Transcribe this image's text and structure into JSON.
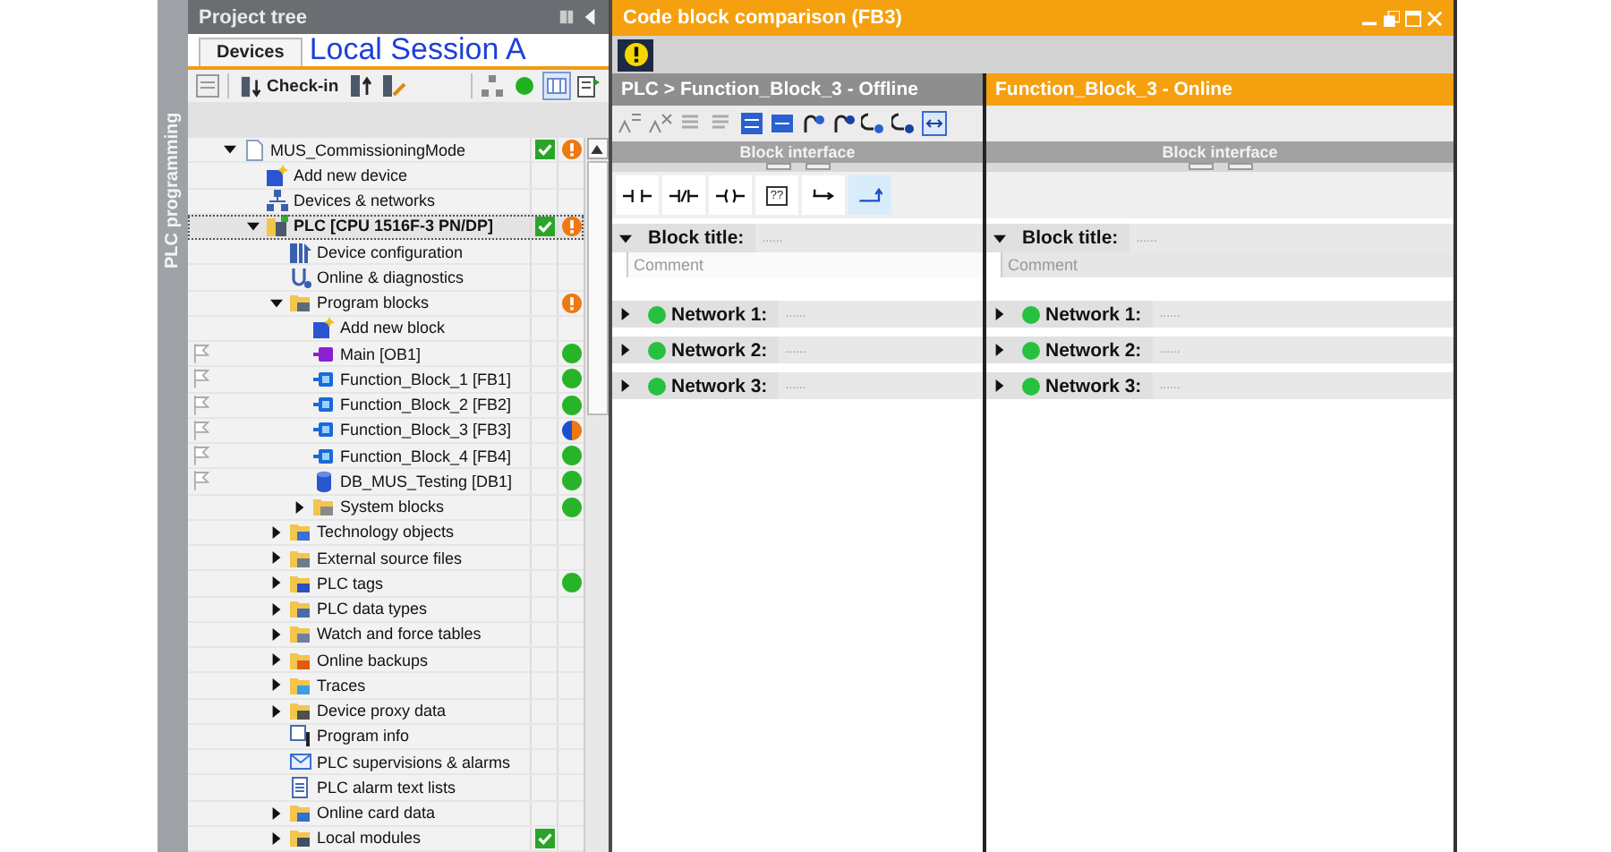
{
  "sidebar": {
    "label": "PLC programming"
  },
  "project_tree": {
    "title": "Project tree",
    "tabs": [
      {
        "label": "Devices",
        "selected": true
      }
    ],
    "annotation": "Local Session A",
    "toolbar": {
      "checkin_label": "Check-in"
    },
    "items": [
      {
        "label": "MUS_CommissioningMode",
        "kind": "project",
        "expanded": true,
        "selected": false,
        "flag": false,
        "check": true,
        "warning": true,
        "children": [
          {
            "label": "Add new device",
            "kind": "add_device",
            "selected": false,
            "flag": false,
            "check": false
          },
          {
            "label": "Devices & networks",
            "kind": "network",
            "selected": false,
            "flag": false,
            "check": false
          },
          {
            "label": "PLC [CPU 1516F-3 PN/DP]",
            "kind": "plc",
            "expanded": true,
            "selected": true,
            "flag": false,
            "check": true,
            "warning": true,
            "children": [
              {
                "label": "Device configuration",
                "kind": "config",
                "selected": false,
                "flag": false,
                "check": false
              },
              {
                "label": "Online & diagnostics",
                "kind": "diagnostics",
                "selected": false,
                "flag": false,
                "check": false
              },
              {
                "label": "Program blocks",
                "kind": "folder_blocks",
                "expanded": true,
                "selected": false,
                "flag": false,
                "check": false,
                "warning": true,
                "children": [
                  {
                    "label": "Add new block",
                    "kind": "add_block",
                    "selected": false,
                    "flag": false,
                    "check": false
                  },
                  {
                    "label": "Main [OB1]",
                    "kind": "ob",
                    "selected": false,
                    "flag": true,
                    "check": false,
                    "online_ok": true
                  },
                  {
                    "label": "Function_Block_1 [FB1]",
                    "kind": "fb",
                    "selected": false,
                    "flag": true,
                    "check": false,
                    "online_ok": true
                  },
                  {
                    "label": "Function_Block_2 [FB2]",
                    "kind": "fb",
                    "selected": false,
                    "flag": true,
                    "check": false,
                    "online_ok": true
                  },
                  {
                    "label": "Function_Block_3 [FB3]",
                    "kind": "fb",
                    "selected": false,
                    "flag": true,
                    "check": false,
                    "online_differs": true
                  },
                  {
                    "label": "Function_Block_4 [FB4]",
                    "kind": "fb",
                    "selected": false,
                    "flag": true,
                    "check": false,
                    "online_ok": true
                  },
                  {
                    "label": "DB_MUS_Testing [DB1]",
                    "kind": "db",
                    "selected": false,
                    "flag": true,
                    "check": false,
                    "online_ok": true
                  },
                  {
                    "label": "System blocks",
                    "kind": "folder_system",
                    "expanded": false,
                    "selected": false,
                    "flag": false,
                    "check": false,
                    "online_ok": true
                  }
                ]
              },
              {
                "label": "Technology objects",
                "kind": "folder_tech",
                "expanded": false,
                "selected": false,
                "flag": false,
                "check": false
              },
              {
                "label": "External source files",
                "kind": "folder_source",
                "expanded": false,
                "selected": false,
                "flag": false,
                "check": false
              },
              {
                "label": "PLC tags",
                "kind": "folder_tags",
                "expanded": false,
                "selected": false,
                "flag": false,
                "check": false,
                "online_ok": true
              },
              {
                "label": "PLC data types",
                "kind": "folder_types",
                "expanded": false,
                "selected": false,
                "flag": false,
                "check": false
              },
              {
                "label": "Watch and force tables",
                "kind": "folder_watch",
                "expanded": false,
                "selected": false,
                "flag": false,
                "check": false
              },
              {
                "label": "Online backups",
                "kind": "folder_backup",
                "expanded": false,
                "selected": false,
                "flag": false,
                "check": false
              },
              {
                "label": "Traces",
                "kind": "folder_traces",
                "expanded": false,
                "selected": false,
                "flag": false,
                "check": false
              },
              {
                "label": "Device proxy data",
                "kind": "folder_proxy",
                "expanded": false,
                "selected": false,
                "flag": false,
                "check": false
              },
              {
                "label": "Program info",
                "kind": "info",
                "selected": false,
                "flag": false,
                "check": false
              },
              {
                "label": "PLC supervisions & alarms",
                "kind": "alarms",
                "selected": false,
                "flag": false,
                "check": false
              },
              {
                "label": "PLC alarm text lists",
                "kind": "textlist",
                "selected": false,
                "flag": false,
                "check": false
              },
              {
                "label": "Online card data",
                "kind": "folder_card",
                "expanded": false,
                "selected": false,
                "flag": false,
                "check": false
              },
              {
                "label": "Local modules",
                "kind": "folder_modules",
                "expanded": false,
                "selected": false,
                "flag": false,
                "check": true
              }
            ]
          }
        ]
      }
    ]
  },
  "editor": {
    "title": "Code block comparison (FB3)",
    "panes": [
      {
        "kind": "offline",
        "title": "PLC > Function_Block_3 - Offline",
        "active": false,
        "interface_label": "Block interface",
        "palette": [
          {
            "kind": "contact",
            "selected": false
          },
          {
            "kind": "negated_contact",
            "selected": false
          },
          {
            "kind": "coil",
            "selected": false
          },
          {
            "kind": "box",
            "label": "??",
            "selected": false
          },
          {
            "kind": "branch_open",
            "selected": false
          },
          {
            "kind": "branch_close",
            "selected": true
          }
        ],
        "block_title": {
          "label": "Block title:",
          "placeholder": "......",
          "expanded": true,
          "comment": "Comment"
        },
        "networks": [
          {
            "label": "Network 1:",
            "placeholder": "......",
            "expanded": false,
            "online_ok": true
          },
          {
            "label": "Network 2:",
            "placeholder": "......",
            "expanded": false,
            "online_ok": true
          },
          {
            "label": "Network 3:",
            "placeholder": "......",
            "expanded": false,
            "online_ok": true
          }
        ]
      },
      {
        "kind": "online",
        "title": "Function_Block_3 - Online",
        "active": true,
        "interface_label": "Block interface",
        "block_title": {
          "label": "Block title:",
          "placeholder": "......",
          "expanded": true,
          "comment": "Comment"
        },
        "networks": [
          {
            "label": "Network 1:",
            "placeholder": "......",
            "expanded": false,
            "online_ok": true
          },
          {
            "label": "Network 2:",
            "placeholder": "......",
            "expanded": false,
            "online_ok": true
          },
          {
            "label": "Network 3:",
            "placeholder": "......",
            "expanded": false,
            "online_ok": true
          }
        ]
      }
    ]
  }
}
